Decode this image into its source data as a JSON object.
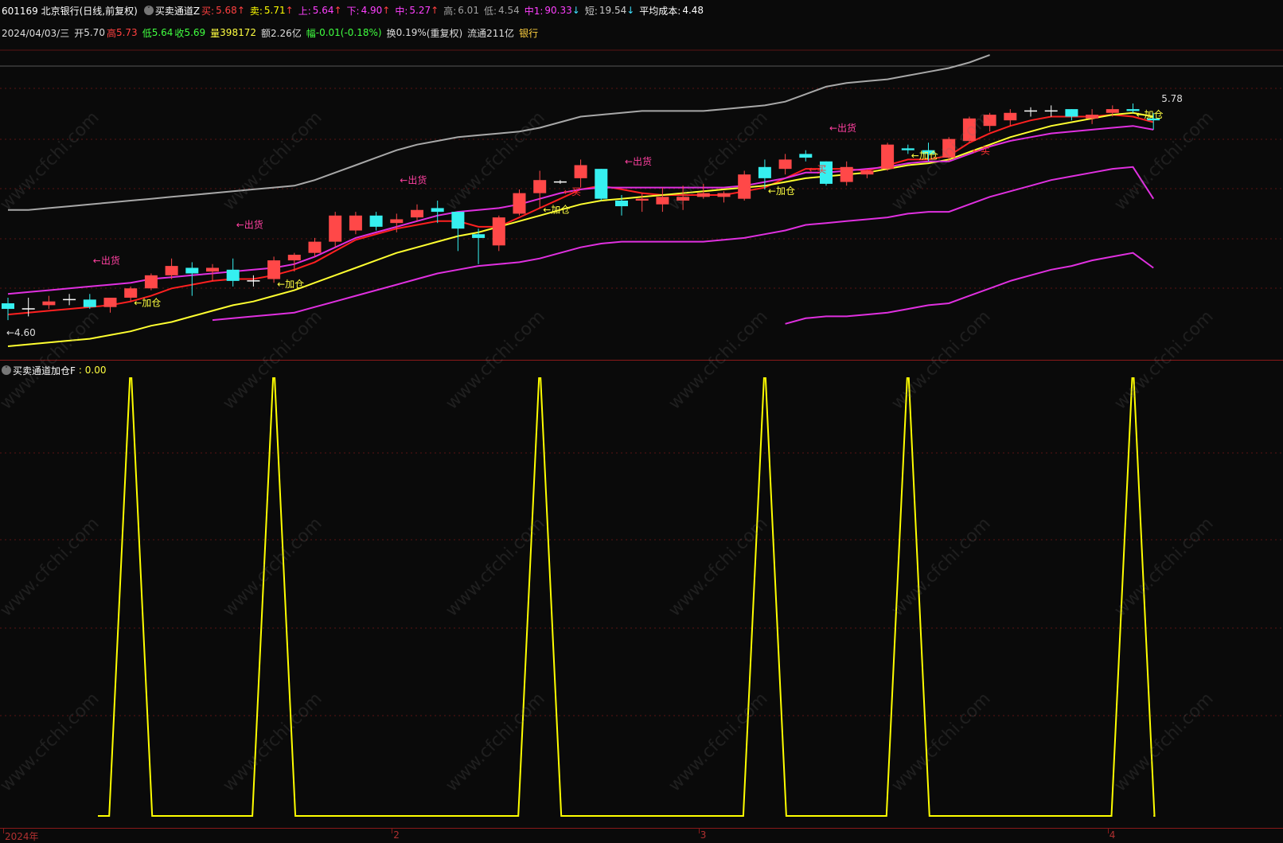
{
  "header": {
    "stock_title": "601169 北京银行(日线,前复权)",
    "indicator_name": "买卖通道Z",
    "items": [
      {
        "label": "买:",
        "value": "5.68",
        "arrow": "↑",
        "color": "#ff4040"
      },
      {
        "label": "卖:",
        "value": "5.71",
        "arrow": "↑",
        "color": "#ffff00"
      },
      {
        "label": "上:",
        "value": "5.64",
        "arrow": "↑",
        "color": "#ff40ff"
      },
      {
        "label": "下:",
        "value": "4.90",
        "arrow": "↑",
        "color": "#ff40ff"
      },
      {
        "label": "中:",
        "value": "5.27",
        "arrow": "↑",
        "color": "#ff40ff"
      },
      {
        "label": "高:",
        "value": "6.01",
        "arrow": "",
        "color": "#a0a0a0"
      },
      {
        "label": "低:",
        "value": "4.54",
        "arrow": "",
        "color": "#a0a0a0"
      },
      {
        "label": "中1:",
        "value": "90.33",
        "arrow": "↓",
        "color": "#ff40ff"
      },
      {
        "label": "短:",
        "value": "19.54",
        "arrow": "↓",
        "color": "#cccccc"
      },
      {
        "label": "平均成本:",
        "value": "4.48",
        "arrow": "",
        "color": "#ffffff"
      }
    ]
  },
  "quote": {
    "date": "2024/04/03/三",
    "open_label": "开",
    "open": "5.70",
    "high_label": "高",
    "high": "5.73",
    "low_label": "低",
    "low": "5.64",
    "close_label": "收",
    "close": "5.69",
    "volume_label": "量",
    "volume": "398172",
    "amount_label": "额",
    "amount": "2.26亿",
    "change_label": "幅",
    "change": "-0.01(-0.18%)",
    "turnover_label": "换",
    "turnover": "0.19%",
    "adjust": "(重复权)",
    "float_label": "流通",
    "float": "211亿",
    "sector": "银行"
  },
  "lower_header": {
    "indicator_name": "买卖通道加仓F",
    "value": ": 0.00"
  },
  "watermark_text": "www.cfchi.com",
  "x_axis": {
    "labels": [
      "2024年",
      "2",
      "3",
      "4"
    ],
    "label_bar_index": [
      0,
      19,
      34,
      54
    ]
  },
  "colors": {
    "up": "#ff4848",
    "down": "#36f0f0",
    "grid": "#5a1414",
    "ma_buy": "#ff2020",
    "ma_sell": "#ffff30",
    "band": "#e030e0",
    "upper_gray": "#a8a8a8",
    "signal_line": "#ffff00",
    "annot_out": "#ff40a0",
    "annot_add": "#ffff40",
    "annot_buy": "#ff3030"
  },
  "chart_data": [
    {
      "type": "candlestick",
      "ylim": [
        4.45,
        6.1
      ],
      "price_labels": {
        "high": "5.78",
        "low": "4.60"
      },
      "candles": [
        {
          "o": 4.71,
          "h": 4.74,
          "l": 4.62,
          "c": 4.68
        },
        {
          "o": 4.68,
          "h": 4.74,
          "l": 4.64,
          "c": 4.68
        },
        {
          "o": 4.7,
          "h": 4.75,
          "l": 4.68,
          "c": 4.72
        },
        {
          "o": 4.73,
          "h": 4.76,
          "l": 4.7,
          "c": 4.73
        },
        {
          "o": 4.73,
          "h": 4.76,
          "l": 4.68,
          "c": 4.69
        },
        {
          "o": 4.69,
          "h": 4.74,
          "l": 4.66,
          "c": 4.74
        },
        {
          "o": 4.74,
          "h": 4.8,
          "l": 4.72,
          "c": 4.79
        },
        {
          "o": 4.79,
          "h": 4.87,
          "l": 4.78,
          "c": 4.86
        },
        {
          "o": 4.86,
          "h": 4.95,
          "l": 4.84,
          "c": 4.91
        },
        {
          "o": 4.9,
          "h": 4.93,
          "l": 4.75,
          "c": 4.87
        },
        {
          "o": 4.88,
          "h": 4.92,
          "l": 4.83,
          "c": 4.9
        },
        {
          "o": 4.89,
          "h": 4.95,
          "l": 4.8,
          "c": 4.83
        },
        {
          "o": 4.83,
          "h": 4.86,
          "l": 4.8,
          "c": 4.83
        },
        {
          "o": 4.84,
          "h": 4.96,
          "l": 4.82,
          "c": 4.94
        },
        {
          "o": 4.94,
          "h": 4.98,
          "l": 4.88,
          "c": 4.97
        },
        {
          "o": 4.98,
          "h": 5.06,
          "l": 4.96,
          "c": 5.04
        },
        {
          "o": 5.04,
          "h": 5.2,
          "l": 5.01,
          "c": 5.18
        },
        {
          "o": 5.1,
          "h": 5.2,
          "l": 5.08,
          "c": 5.18
        },
        {
          "o": 5.18,
          "h": 5.2,
          "l": 5.1,
          "c": 5.12
        },
        {
          "o": 5.14,
          "h": 5.19,
          "l": 5.09,
          "c": 5.16
        },
        {
          "o": 5.17,
          "h": 5.24,
          "l": 5.15,
          "c": 5.21
        },
        {
          "o": 5.22,
          "h": 5.26,
          "l": 5.14,
          "c": 5.2
        },
        {
          "o": 5.2,
          "h": 5.2,
          "l": 4.99,
          "c": 5.11
        },
        {
          "o": 5.08,
          "h": 5.11,
          "l": 4.92,
          "c": 5.06
        },
        {
          "o": 5.02,
          "h": 5.18,
          "l": 4.99,
          "c": 5.17
        },
        {
          "o": 5.19,
          "h": 5.32,
          "l": 5.18,
          "c": 5.3
        },
        {
          "o": 5.3,
          "h": 5.42,
          "l": 5.22,
          "c": 5.37
        },
        {
          "o": 5.36,
          "h": 5.37,
          "l": 5.35,
          "c": 5.36
        },
        {
          "o": 5.38,
          "h": 5.48,
          "l": 5.33,
          "c": 5.45
        },
        {
          "o": 5.43,
          "h": 5.43,
          "l": 5.26,
          "c": 5.27
        },
        {
          "o": 5.26,
          "h": 5.29,
          "l": 5.18,
          "c": 5.23
        },
        {
          "o": 5.26,
          "h": 5.3,
          "l": 5.2,
          "c": 5.27
        },
        {
          "o": 5.24,
          "h": 5.33,
          "l": 5.2,
          "c": 5.28
        },
        {
          "o": 5.26,
          "h": 5.34,
          "l": 5.21,
          "c": 5.28
        },
        {
          "o": 5.28,
          "h": 5.35,
          "l": 5.27,
          "c": 5.3
        },
        {
          "o": 5.28,
          "h": 5.31,
          "l": 5.25,
          "c": 5.3
        },
        {
          "o": 5.27,
          "h": 5.42,
          "l": 5.26,
          "c": 5.4
        },
        {
          "o": 5.44,
          "h": 5.48,
          "l": 5.32,
          "c": 5.38
        },
        {
          "o": 5.43,
          "h": 5.51,
          "l": 5.4,
          "c": 5.48
        },
        {
          "o": 5.51,
          "h": 5.53,
          "l": 5.47,
          "c": 5.49
        },
        {
          "o": 5.47,
          "h": 5.47,
          "l": 5.34,
          "c": 5.35
        },
        {
          "o": 5.36,
          "h": 5.47,
          "l": 5.34,
          "c": 5.44
        },
        {
          "o": 5.4,
          "h": 5.43,
          "l": 5.38,
          "c": 5.42
        },
        {
          "o": 5.43,
          "h": 5.57,
          "l": 5.42,
          "c": 5.56
        },
        {
          "o": 5.54,
          "h": 5.56,
          "l": 5.51,
          "c": 5.53
        },
        {
          "o": 5.53,
          "h": 5.57,
          "l": 5.47,
          "c": 5.51
        },
        {
          "o": 5.49,
          "h": 5.6,
          "l": 5.47,
          "c": 5.59
        },
        {
          "o": 5.58,
          "h": 5.71,
          "l": 5.57,
          "c": 5.7
        },
        {
          "o": 5.66,
          "h": 5.73,
          "l": 5.63,
          "c": 5.72
        },
        {
          "o": 5.69,
          "h": 5.75,
          "l": 5.66,
          "c": 5.73
        },
        {
          "o": 5.74,
          "h": 5.76,
          "l": 5.71,
          "c": 5.74
        },
        {
          "o": 5.74,
          "h": 5.77,
          "l": 5.71,
          "c": 5.74
        },
        {
          "o": 5.75,
          "h": 5.75,
          "l": 5.69,
          "c": 5.71
        },
        {
          "o": 5.7,
          "h": 5.75,
          "l": 5.67,
          "c": 5.72
        },
        {
          "o": 5.73,
          "h": 5.77,
          "l": 5.71,
          "c": 5.75
        },
        {
          "o": 5.75,
          "h": 5.78,
          "l": 5.73,
          "c": 5.74
        },
        {
          "o": 5.7,
          "h": 5.73,
          "l": 5.64,
          "c": 5.69
        }
      ],
      "series": [
        {
          "name": "买",
          "values": [
            4.65,
            4.66,
            4.67,
            4.68,
            4.69,
            4.7,
            4.72,
            4.75,
            4.79,
            4.81,
            4.83,
            4.84,
            4.84,
            4.86,
            4.89,
            4.93,
            4.99,
            5.05,
            5.08,
            5.11,
            5.13,
            5.15,
            5.15,
            5.12,
            5.12,
            5.17,
            5.22,
            5.27,
            5.32,
            5.34,
            5.32,
            5.3,
            5.29,
            5.29,
            5.29,
            5.29,
            5.31,
            5.33,
            5.38,
            5.43,
            5.43,
            5.43,
            5.42,
            5.45,
            5.48,
            5.48,
            5.5,
            5.57,
            5.62,
            5.66,
            5.69,
            5.71,
            5.71,
            5.71,
            5.72,
            5.71,
            5.68
          ]
        },
        {
          "name": "卖",
          "values": [
            4.48,
            4.49,
            4.5,
            4.51,
            4.52,
            4.54,
            4.56,
            4.59,
            4.61,
            4.64,
            4.67,
            4.7,
            4.72,
            4.75,
            4.78,
            4.82,
            4.86,
            4.9,
            4.94,
            4.98,
            5.01,
            5.04,
            5.07,
            5.09,
            5.12,
            5.15,
            5.18,
            5.21,
            5.24,
            5.26,
            5.27,
            5.28,
            5.29,
            5.3,
            5.31,
            5.32,
            5.33,
            5.34,
            5.36,
            5.38,
            5.39,
            5.4,
            5.41,
            5.43,
            5.45,
            5.46,
            5.48,
            5.52,
            5.56,
            5.6,
            5.63,
            5.66,
            5.68,
            5.7,
            5.72,
            5.73,
            5.71
          ]
        },
        {
          "name": "上",
          "values": [
            4.76,
            4.77,
            4.78,
            4.79,
            4.8,
            4.81,
            4.82,
            4.84,
            4.85,
            4.86,
            4.87,
            4.88,
            4.89,
            4.9,
            4.92,
            4.96,
            5.01,
            5.06,
            5.09,
            5.12,
            5.15,
            5.18,
            5.2,
            5.21,
            5.22,
            5.24,
            5.27,
            5.3,
            5.32,
            5.33,
            5.33,
            5.33,
            5.33,
            5.33,
            5.33,
            5.33,
            5.34,
            5.36,
            5.38,
            5.41,
            5.41,
            5.42,
            5.43,
            5.44,
            5.46,
            5.47,
            5.47,
            5.51,
            5.55,
            5.58,
            5.6,
            5.62,
            5.63,
            5.64,
            5.65,
            5.66,
            5.64
          ]
        },
        {
          "name": "中",
          "values": [
            null,
            null,
            null,
            null,
            null,
            null,
            null,
            null,
            null,
            null,
            4.62,
            4.63,
            4.64,
            4.65,
            4.66,
            4.69,
            4.72,
            4.75,
            4.78,
            4.81,
            4.84,
            4.87,
            4.89,
            4.91,
            4.92,
            4.93,
            4.95,
            4.98,
            5.01,
            5.03,
            5.04,
            5.04,
            5.04,
            5.04,
            5.04,
            5.05,
            5.06,
            5.08,
            5.1,
            5.13,
            5.14,
            5.15,
            5.16,
            5.17,
            5.19,
            5.2,
            5.2,
            5.24,
            5.28,
            5.31,
            5.34,
            5.37,
            5.39,
            5.41,
            5.43,
            5.44,
            5.27
          ]
        },
        {
          "name": "下",
          "values": [
            null,
            null,
            null,
            null,
            null,
            null,
            null,
            null,
            null,
            null,
            null,
            null,
            null,
            null,
            null,
            null,
            null,
            null,
            null,
            null,
            null,
            null,
            null,
            null,
            null,
            null,
            null,
            null,
            null,
            null,
            null,
            null,
            null,
            null,
            null,
            null,
            null,
            null,
            4.6,
            4.63,
            4.64,
            4.64,
            4.65,
            4.66,
            4.68,
            4.7,
            4.71,
            4.75,
            4.79,
            4.83,
            4.86,
            4.89,
            4.91,
            4.94,
            4.96,
            4.98,
            4.9
          ]
        },
        {
          "name": "高",
          "values": [
            5.21,
            5.21,
            5.22,
            5.23,
            5.24,
            5.25,
            5.26,
            5.27,
            5.28,
            5.29,
            5.3,
            5.31,
            5.32,
            5.33,
            5.34,
            5.37,
            5.41,
            5.45,
            5.49,
            5.53,
            5.56,
            5.58,
            5.6,
            5.61,
            5.62,
            5.63,
            5.65,
            5.68,
            5.71,
            5.72,
            5.73,
            5.74,
            5.74,
            5.74,
            5.74,
            5.75,
            5.76,
            5.77,
            5.79,
            5.83,
            5.87,
            5.89,
            5.9,
            5.91,
            5.93,
            5.95,
            5.97,
            6.0,
            6.04,
            null,
            null,
            null,
            null,
            null,
            null,
            null,
            null
          ]
        }
      ],
      "annotations": [
        {
          "i": 0,
          "text": "←4.60",
          "kind": "low"
        },
        {
          "i": 4,
          "text": "←出货",
          "kind": "out"
        },
        {
          "i": 6,
          "text": "←加仓",
          "kind": "add"
        },
        {
          "i": 11,
          "text": "←出货",
          "kind": "out"
        },
        {
          "i": 13,
          "text": "←加仓",
          "kind": "add"
        },
        {
          "i": 19,
          "text": "←出货",
          "kind": "out"
        },
        {
          "i": 26,
          "text": "←加仓",
          "kind": "add"
        },
        {
          "i": 27,
          "text": "←买",
          "kind": "buy"
        },
        {
          "i": 30,
          "text": "←出货",
          "kind": "out"
        },
        {
          "i": 37,
          "text": "←加仓",
          "kind": "add"
        },
        {
          "i": 39,
          "text": "←买",
          "kind": "buy"
        },
        {
          "i": 40,
          "text": "←出货",
          "kind": "out"
        },
        {
          "i": 44,
          "text": "←加仓",
          "kind": "add"
        },
        {
          "i": 47,
          "text": "←买",
          "kind": "buy"
        },
        {
          "i": 55,
          "text": "←加仓",
          "kind": "add"
        },
        {
          "i": 56,
          "text": "5.78",
          "kind": "high"
        }
      ]
    },
    {
      "type": "line",
      "series": [
        {
          "name": "买卖通道加仓F",
          "values": [
            0,
            0,
            0,
            0,
            0,
            0,
            1,
            0,
            0,
            0,
            0,
            0,
            0,
            1,
            0,
            0,
            0,
            0,
            0,
            0,
            0,
            0,
            0,
            0,
            0,
            0,
            1,
            0,
            0,
            0,
            0,
            0,
            0,
            0,
            0,
            0,
            0,
            1,
            0,
            0,
            0,
            0,
            0,
            0,
            1,
            0,
            0,
            0,
            0,
            0,
            0,
            0,
            0,
            0,
            0,
            1,
            0
          ]
        }
      ],
      "ylim": [
        0,
        1
      ]
    }
  ]
}
